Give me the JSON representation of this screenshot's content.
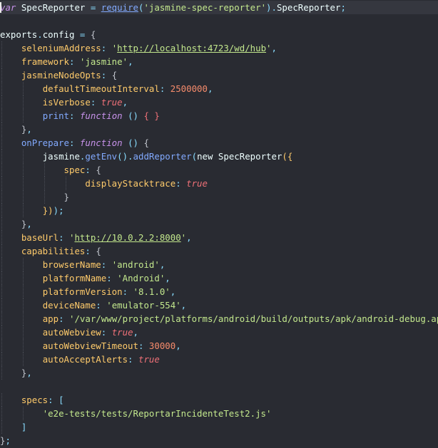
{
  "editor": {
    "lines": [
      [
        [
          "kw",
          "var"
        ],
        [
          "txt",
          " SpecReporter "
        ],
        [
          "punc",
          "="
        ],
        [
          "txt",
          " "
        ],
        [
          "fnu",
          "require"
        ],
        [
          "punc",
          "("
        ],
        [
          "str",
          "'jasmine-spec-reporter'"
        ],
        [
          "punc",
          ")."
        ],
        [
          "txt",
          "SpecReporter"
        ],
        [
          "punc",
          ";"
        ]
      ],
      [],
      [
        [
          "txt",
          "exports"
        ],
        [
          "punc",
          "."
        ],
        [
          "txt",
          "config "
        ],
        [
          "punc",
          "="
        ],
        [
          "txt",
          " "
        ],
        [
          "brace",
          "{"
        ]
      ],
      [
        [
          "txt",
          "    "
        ],
        [
          "prop",
          "seleniumAddress"
        ],
        [
          "punc",
          ":"
        ],
        [
          "txt",
          " "
        ],
        [
          "str",
          "'"
        ],
        [
          "url",
          "http://localhost:4723/wd/hub"
        ],
        [
          "str",
          "'"
        ],
        [
          "punc",
          ","
        ]
      ],
      [
        [
          "txt",
          "    "
        ],
        [
          "prop",
          "framework"
        ],
        [
          "punc",
          ":"
        ],
        [
          "txt",
          " "
        ],
        [
          "str",
          "'jasmine'"
        ],
        [
          "punc",
          ","
        ]
      ],
      [
        [
          "txt",
          "    "
        ],
        [
          "prop",
          "jasmineNodeOpts"
        ],
        [
          "punc",
          ":"
        ],
        [
          "txt",
          " "
        ],
        [
          "brace",
          "{"
        ]
      ],
      [
        [
          "txt",
          "        "
        ],
        [
          "prop",
          "defaultTimeoutInterval"
        ],
        [
          "punc",
          ":"
        ],
        [
          "txt",
          " "
        ],
        [
          "num",
          "2500000"
        ],
        [
          "punc",
          ","
        ]
      ],
      [
        [
          "txt",
          "        "
        ],
        [
          "prop",
          "isVerbose"
        ],
        [
          "punc",
          ":"
        ],
        [
          "txt",
          " "
        ],
        [
          "bool",
          "true"
        ],
        [
          "punc",
          ","
        ]
      ],
      [
        [
          "txt",
          "        "
        ],
        [
          "fn",
          "print"
        ],
        [
          "punc",
          ":"
        ],
        [
          "txt",
          " "
        ],
        [
          "kw",
          "function"
        ],
        [
          "txt",
          " "
        ],
        [
          "punc",
          "()"
        ],
        [
          "txt",
          " "
        ],
        [
          "brk2",
          "{ }"
        ]
      ],
      [
        [
          "txt",
          "    "
        ],
        [
          "brace",
          "}"
        ],
        [
          "punc",
          ","
        ]
      ],
      [
        [
          "txt",
          "    "
        ],
        [
          "fn",
          "onPrepare"
        ],
        [
          "punc",
          ":"
        ],
        [
          "txt",
          " "
        ],
        [
          "kw",
          "function"
        ],
        [
          "txt",
          " "
        ],
        [
          "punc",
          "()"
        ],
        [
          "txt",
          " "
        ],
        [
          "brace",
          "{"
        ]
      ],
      [
        [
          "txt",
          "        "
        ],
        [
          "txt",
          "jasmine"
        ],
        [
          "punc",
          "."
        ],
        [
          "fn",
          "getEnv"
        ],
        [
          "punc",
          "()."
        ],
        [
          "fn",
          "addReporter"
        ],
        [
          "punc",
          "("
        ],
        [
          "txt",
          "new SpecReporter"
        ],
        [
          "brk",
          "({"
        ]
      ],
      [
        [
          "txt",
          "            "
        ],
        [
          "prop",
          "spec"
        ],
        [
          "punc",
          ":"
        ],
        [
          "txt",
          " "
        ],
        [
          "brace",
          "{"
        ]
      ],
      [
        [
          "txt",
          "                "
        ],
        [
          "prop",
          "displayStacktrace"
        ],
        [
          "punc",
          ":"
        ],
        [
          "txt",
          " "
        ],
        [
          "bool",
          "true"
        ]
      ],
      [
        [
          "txt",
          "            "
        ],
        [
          "brace",
          "}"
        ]
      ],
      [
        [
          "txt",
          "        "
        ],
        [
          "brk",
          "})"
        ],
        [
          "punc",
          ");"
        ]
      ],
      [
        [
          "txt",
          "    "
        ],
        [
          "brace",
          "}"
        ],
        [
          "punc",
          ","
        ]
      ],
      [
        [
          "txt",
          "    "
        ],
        [
          "prop",
          "baseUrl"
        ],
        [
          "punc",
          ":"
        ],
        [
          "txt",
          " "
        ],
        [
          "str",
          "'"
        ],
        [
          "url",
          "http://10.0.2.2:8000"
        ],
        [
          "str",
          "'"
        ],
        [
          "punc",
          ","
        ]
      ],
      [
        [
          "txt",
          "    "
        ],
        [
          "prop",
          "capabilities"
        ],
        [
          "punc",
          ":"
        ],
        [
          "txt",
          " "
        ],
        [
          "brace",
          "{"
        ]
      ],
      [
        [
          "txt",
          "        "
        ],
        [
          "prop",
          "browserName"
        ],
        [
          "punc",
          ":"
        ],
        [
          "txt",
          " "
        ],
        [
          "str",
          "'android'"
        ],
        [
          "punc",
          ","
        ]
      ],
      [
        [
          "txt",
          "        "
        ],
        [
          "prop",
          "platformName"
        ],
        [
          "punc",
          ":"
        ],
        [
          "txt",
          " "
        ],
        [
          "str",
          "'Android'"
        ],
        [
          "punc",
          ","
        ]
      ],
      [
        [
          "txt",
          "        "
        ],
        [
          "prop",
          "platformVersion"
        ],
        [
          "punc",
          ":"
        ],
        [
          "txt",
          " "
        ],
        [
          "str",
          "'8.1.0'"
        ],
        [
          "punc",
          ","
        ]
      ],
      [
        [
          "txt",
          "        "
        ],
        [
          "prop",
          "deviceName"
        ],
        [
          "punc",
          ":"
        ],
        [
          "txt",
          " "
        ],
        [
          "str",
          "'emulator-554'"
        ],
        [
          "punc",
          ","
        ]
      ],
      [
        [
          "txt",
          "        "
        ],
        [
          "prop",
          "app"
        ],
        [
          "punc",
          ":"
        ],
        [
          "txt",
          " "
        ],
        [
          "str",
          "'/var/www/project/platforms/android/build/outputs/apk/android-debug.apk'"
        ],
        [
          "punc",
          ","
        ]
      ],
      [
        [
          "txt",
          "        "
        ],
        [
          "prop",
          "autoWebview"
        ],
        [
          "punc",
          ":"
        ],
        [
          "txt",
          " "
        ],
        [
          "bool",
          "true"
        ],
        [
          "punc",
          ","
        ]
      ],
      [
        [
          "txt",
          "        "
        ],
        [
          "prop",
          "autoWebviewTimeout"
        ],
        [
          "punc",
          ":"
        ],
        [
          "txt",
          " "
        ],
        [
          "num",
          "30000"
        ],
        [
          "punc",
          ","
        ]
      ],
      [
        [
          "txt",
          "        "
        ],
        [
          "prop",
          "autoAcceptAlerts"
        ],
        [
          "punc",
          ":"
        ],
        [
          "txt",
          " "
        ],
        [
          "bool",
          "true"
        ]
      ],
      [
        [
          "txt",
          "    "
        ],
        [
          "brace",
          "}"
        ],
        [
          "punc",
          ","
        ]
      ],
      [],
      [
        [
          "txt",
          "    "
        ],
        [
          "prop",
          "specs"
        ],
        [
          "punc",
          ":"
        ],
        [
          "txt",
          " "
        ],
        [
          "punc",
          "["
        ]
      ],
      [
        [
          "txt",
          "        "
        ],
        [
          "str",
          "'e2e-tests/tests/ReportarIncidenteTest2.js'"
        ]
      ],
      [
        [
          "txt",
          "    "
        ],
        [
          "punc",
          "]"
        ]
      ],
      [
        [
          "brace",
          "}"
        ],
        [
          "punc",
          ";"
        ]
      ]
    ]
  },
  "colors": {
    "background": "#292b32",
    "active_line": "#35373f",
    "keyword": "#c792ea",
    "property": "#ffcb6b",
    "function": "#82aaff",
    "string": "#c3e88d",
    "number": "#f78c6c",
    "boolean": "#f07178"
  }
}
